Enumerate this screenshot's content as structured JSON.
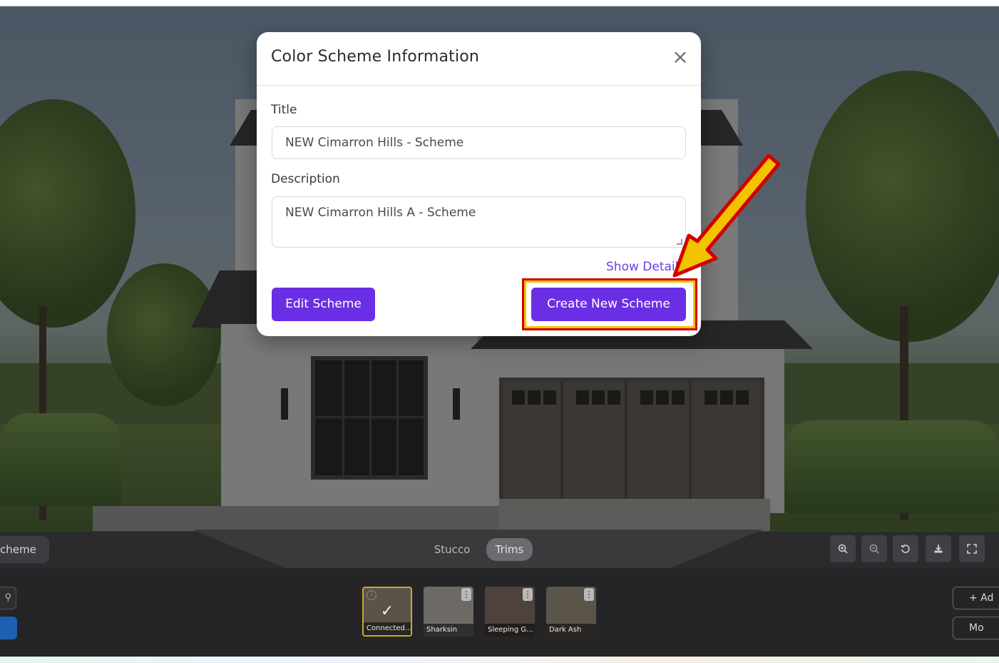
{
  "modal": {
    "title": "Color Scheme Information",
    "close_icon": "×",
    "title_label": "Title",
    "title_value": "NEW Cimarron Hills - Scheme",
    "description_label": "Description",
    "description_value": "NEW Cimarron Hills A - Scheme",
    "show_details": "Show Details",
    "edit_button": "Edit Scheme",
    "create_button": "Create New Scheme"
  },
  "toolbar": {
    "scheme_tab": "cheme",
    "segments": [
      "Stucco",
      "Trims"
    ],
    "active_segment": "Trims",
    "icons": [
      "zoom-in-icon",
      "zoom-out-icon",
      "reset-icon",
      "download-icon",
      "fullscreen-icon"
    ]
  },
  "swatches": [
    {
      "label": "Connected...",
      "selected": true,
      "color": "#5a5347"
    },
    {
      "label": "Sharksin",
      "selected": false,
      "color": "#6d6a66"
    },
    {
      "label": "Sleeping G...",
      "selected": false,
      "color": "#4e433c"
    },
    {
      "label": "Dark Ash",
      "selected": false,
      "color": "#5b5449"
    }
  ],
  "right_buttons": {
    "add": "+ Ad",
    "more": "Mo"
  },
  "colors": {
    "accent": "#6a2fe4",
    "link": "#6a3ee6",
    "highlight_red": "#d10000",
    "highlight_yellow": "#f4c300"
  }
}
